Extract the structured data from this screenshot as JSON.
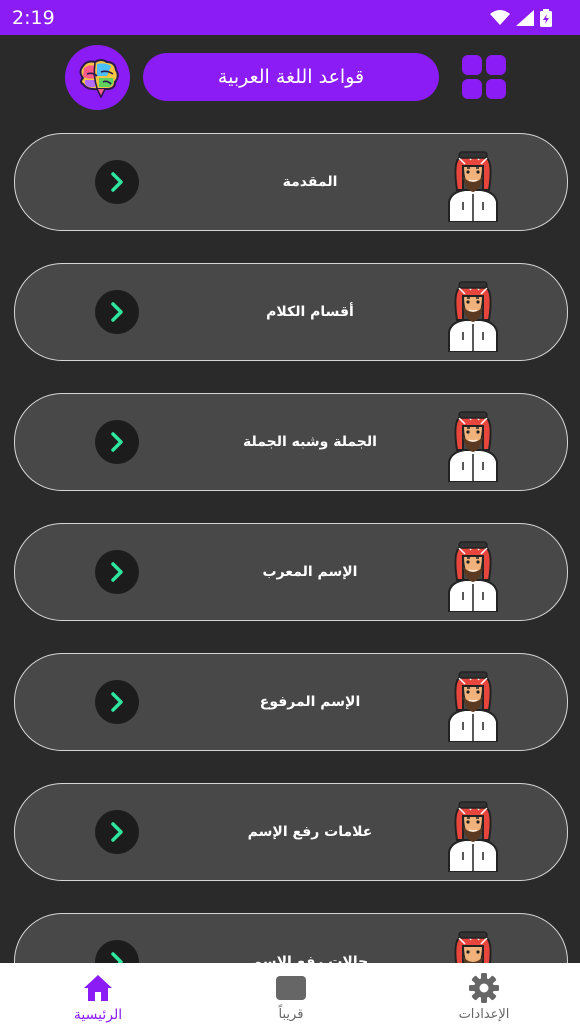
{
  "status_bar": {
    "time": "2:19",
    "battery_icon": "battery-charging-icon",
    "signal_icon": "signal-icon",
    "wifi_icon": "wifi-icon"
  },
  "header": {
    "title": "قواعد اللغة العربية",
    "logo_icon": "brain-icon",
    "menu_icon": "grid-icon"
  },
  "colors": {
    "accent": "#8b1cf5",
    "card": "#484848",
    "background": "#2a2a2a",
    "chevron": "#2ee6a0"
  },
  "lessons": [
    {
      "label": "المقدمة"
    },
    {
      "label": "أقسام الكلام"
    },
    {
      "label": "الجملة وشبه الجملة"
    },
    {
      "label": "الإسم المعرب"
    },
    {
      "label": "الإسم المرفوع"
    },
    {
      "label": "علامات رفع الإسم"
    },
    {
      "label": "حالات رفع الإسم"
    }
  ],
  "bottom_nav": {
    "home": "الرئيسية",
    "soon": "قريباً",
    "settings": "الإعدادات"
  }
}
